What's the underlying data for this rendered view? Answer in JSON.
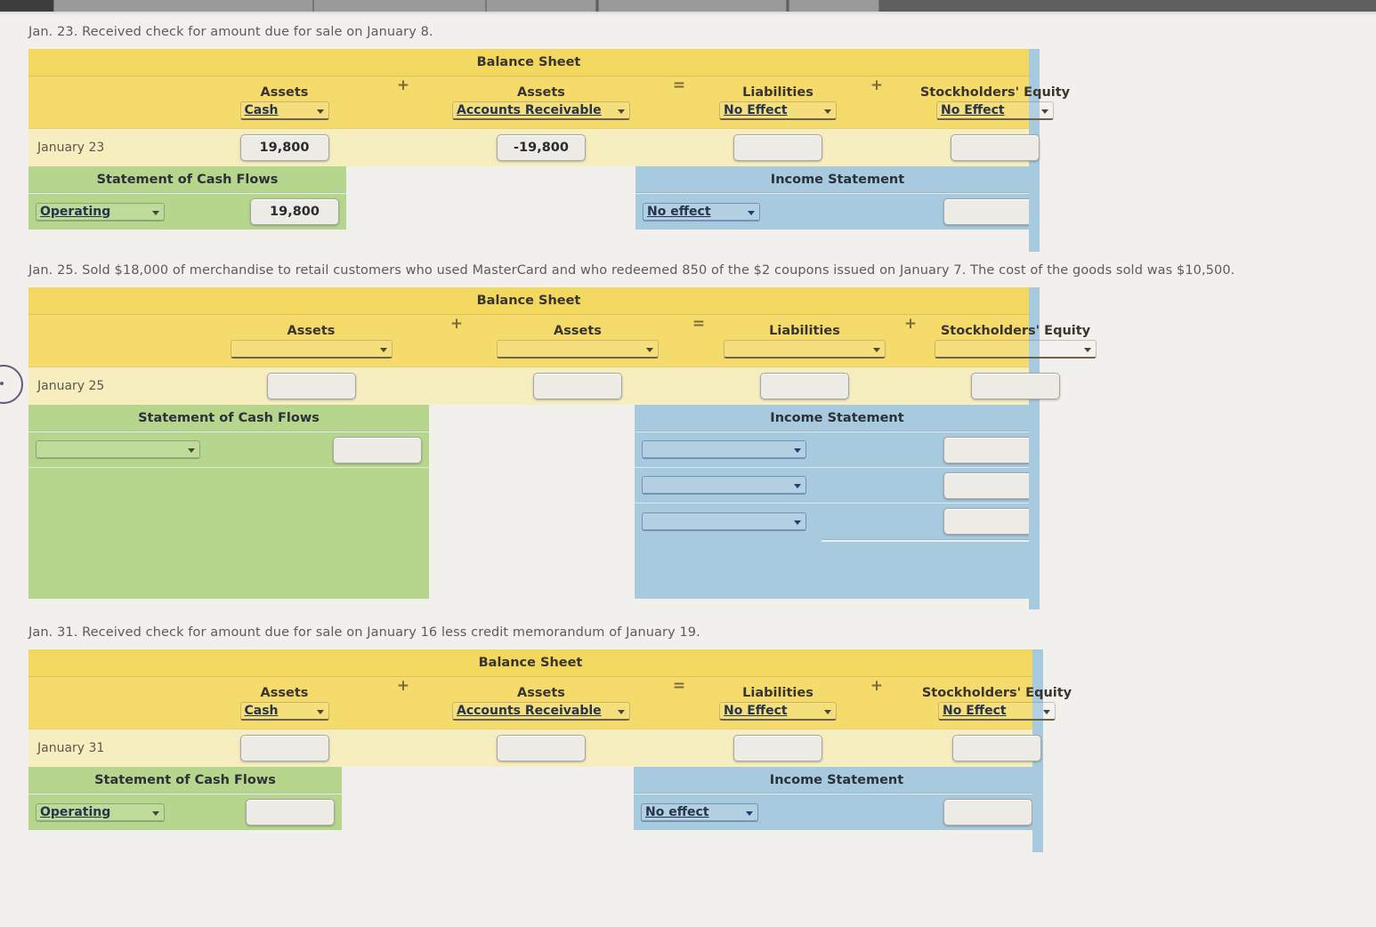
{
  "window": {
    "tab_count": 5
  },
  "transactions": [
    {
      "id": "jan23",
      "prompt": "Jan. 23. Received check for amount due for sale on January 8.",
      "balance_sheet": {
        "title": "Balance Sheet",
        "columns": [
          {
            "heading": "Assets",
            "account": "Cash",
            "operator_after": "+"
          },
          {
            "heading": "Assets",
            "account": "Accounts Receivable",
            "operator_after": "="
          },
          {
            "heading": "Liabilities",
            "account": "No Effect",
            "operator_after": "+"
          },
          {
            "heading": "Stockholders' Equity",
            "account": "No Effect",
            "operator_after": ""
          }
        ],
        "row_label": "January 23",
        "values": [
          "19,800",
          "-19,800",
          "",
          ""
        ]
      },
      "cash_flows": {
        "title": "Statement of Cash Flows",
        "rows": [
          {
            "category": "Operating",
            "amount": "19,800"
          }
        ]
      },
      "income_statement": {
        "title": "Income Statement",
        "rows": [
          {
            "account": "No effect",
            "amount": ""
          }
        ]
      }
    },
    {
      "id": "jan25",
      "prompt": "Jan. 25. Sold $18,000 of merchandise to retail customers who used MasterCard and who redeemed 850 of the $2 coupons issued on January 7. The cost of the goods sold was $10,500.",
      "balance_sheet": {
        "title": "Balance Sheet",
        "columns": [
          {
            "heading": "Assets",
            "account": "",
            "operator_after": "+"
          },
          {
            "heading": "Assets",
            "account": "",
            "operator_after": "="
          },
          {
            "heading": "Liabilities",
            "account": "",
            "operator_after": "+"
          },
          {
            "heading": "Stockholders' Equity",
            "account": "",
            "operator_after": ""
          }
        ],
        "row_label": "January 25",
        "values": [
          "",
          "",
          "",
          ""
        ]
      },
      "cash_flows": {
        "title": "Statement of Cash Flows",
        "rows": [
          {
            "category": "",
            "amount": ""
          }
        ]
      },
      "income_statement": {
        "title": "Income Statement",
        "rows": [
          {
            "account": "",
            "amount": ""
          },
          {
            "account": "",
            "amount": ""
          },
          {
            "account": "",
            "amount": ""
          }
        ]
      }
    },
    {
      "id": "jan31",
      "prompt": "Jan. 31. Received check for amount due for sale on January 16 less credit memorandum of January 19.",
      "balance_sheet": {
        "title": "Balance Sheet",
        "columns": [
          {
            "heading": "Assets",
            "account": "Cash",
            "operator_after": "+"
          },
          {
            "heading": "Assets",
            "account": "Accounts Receivable",
            "operator_after": "="
          },
          {
            "heading": "Liabilities",
            "account": "No Effect",
            "operator_after": "+"
          },
          {
            "heading": "Stockholders' Equity",
            "account": "No Effect",
            "operator_after": ""
          }
        ],
        "row_label": "January 31",
        "values": [
          "",
          "",
          "",
          ""
        ]
      },
      "cash_flows": {
        "title": "Statement of Cash Flows",
        "rows": [
          {
            "category": "Operating",
            "amount": ""
          }
        ]
      },
      "income_statement": {
        "title": "Income Statement",
        "rows": [
          {
            "account": "No effect",
            "amount": ""
          }
        ]
      }
    }
  ],
  "colors": {
    "page_bg": "#f1f0ec",
    "balance_sheet_header": "#f2d85f",
    "balance_sheet_row": "#f7eec0",
    "cash_flows_bg": "#b6d68d",
    "income_statement_bg": "#a8cadf",
    "select_text": "#27344e"
  }
}
